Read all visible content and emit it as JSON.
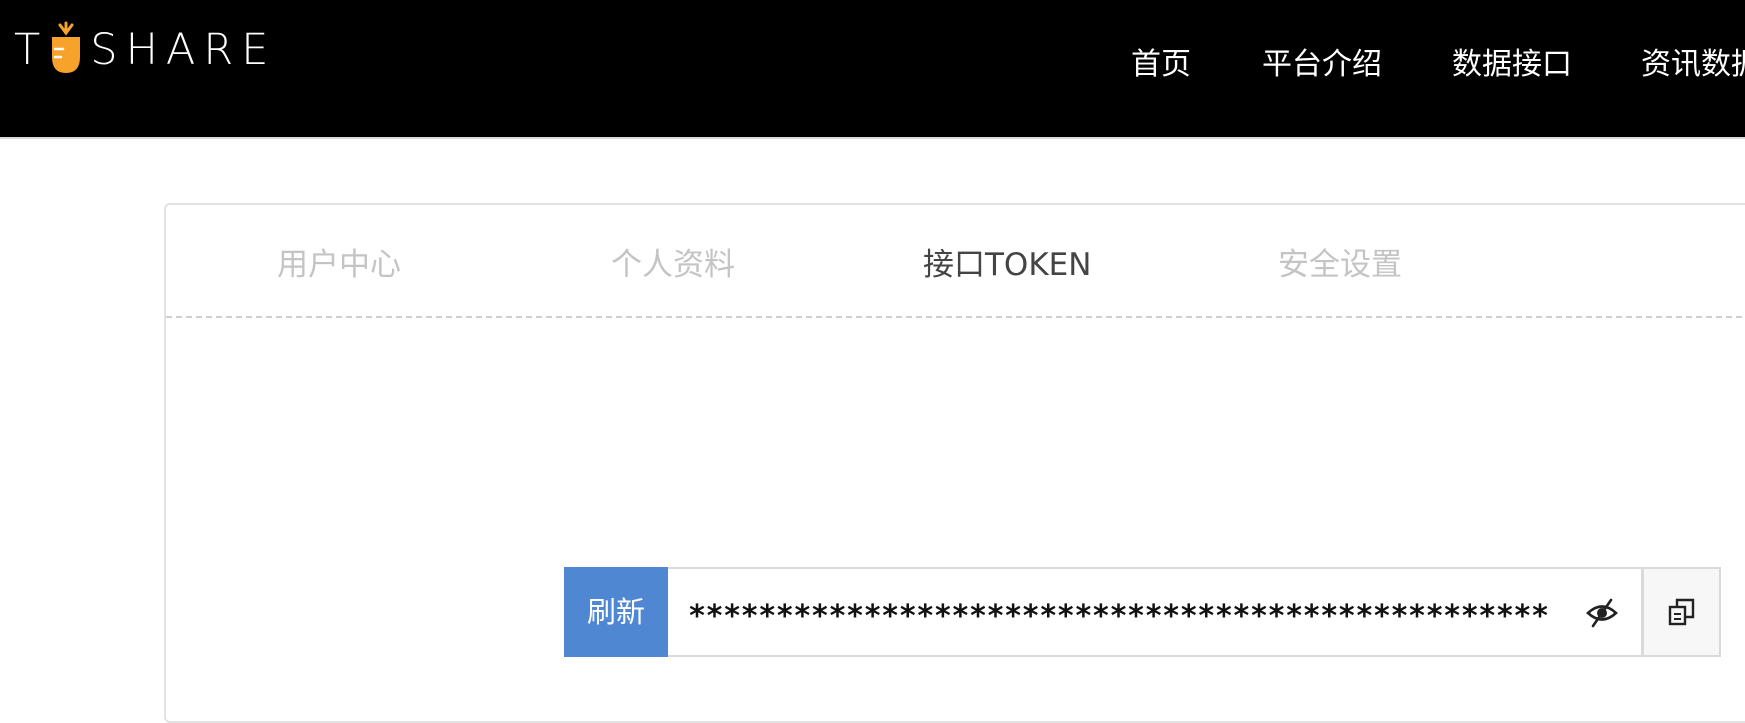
{
  "brand": {
    "logo_text_before": "T",
    "logo_text_after": "SHARE",
    "accent_color": "#f7a22b"
  },
  "nav": {
    "items": [
      {
        "label": "首页"
      },
      {
        "label": "平台介绍"
      },
      {
        "label": "数据接口"
      },
      {
        "label": "资讯数据"
      }
    ]
  },
  "tabs": {
    "items": [
      {
        "label": "用户中心",
        "active": false
      },
      {
        "label": "个人资料",
        "active": false
      },
      {
        "label": "接口TOKEN",
        "active": true
      },
      {
        "label": "安全设置",
        "active": false
      }
    ]
  },
  "token": {
    "refresh_label": "刷新",
    "masked_value": "****************************************************************",
    "visibility_icon": "eye-slash-icon",
    "copy_icon": "copy-icon"
  },
  "colors": {
    "topbar": "#000000",
    "refresh_button": "#5087d2",
    "tab_inactive": "#c4c4c4",
    "tab_active": "#444444"
  }
}
